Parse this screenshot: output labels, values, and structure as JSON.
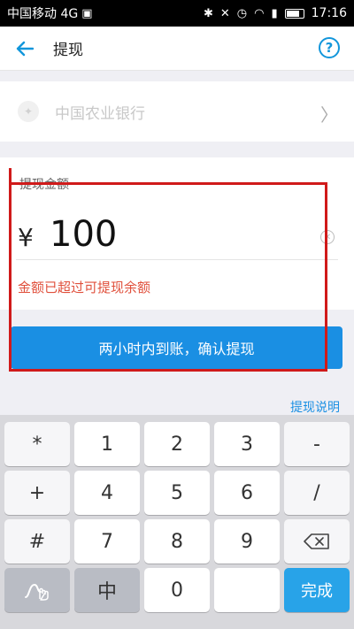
{
  "status_bar": {
    "carrier": "中国移动 4G",
    "time": "17:16",
    "network": "4G"
  },
  "header": {
    "title": "提现",
    "back_icon": "arrow-left-icon",
    "help_icon": "question-circle-icon"
  },
  "bank": {
    "name": "中国农业银行"
  },
  "amount": {
    "label": "提现金额",
    "currency": "¥",
    "value": "100",
    "error": "金额已超过可提现余额"
  },
  "confirm_button": "两小时内到账，确认提现",
  "help_link": "提现说明",
  "keyboard": {
    "row1": [
      "*",
      "1",
      "2",
      "3",
      "-"
    ],
    "row2": [
      "+",
      "4",
      "5",
      "6",
      "/"
    ],
    "row3": [
      "#",
      "7",
      "8",
      "9"
    ],
    "row4_mid": "中",
    "row4_zero": "0",
    "row4_space": "",
    "done": "完成"
  },
  "colors": {
    "accent": "#1a8fe3",
    "error": "#e0503c",
    "annotation": "#d01a1a"
  }
}
